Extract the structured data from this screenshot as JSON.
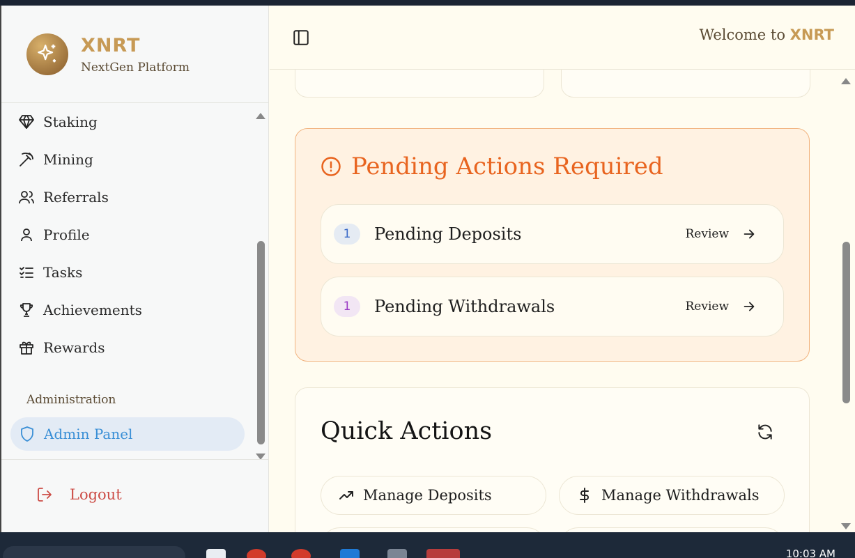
{
  "brand": {
    "name": "XNRT",
    "subtitle": "NextGen Platform"
  },
  "sidebar": {
    "items": [
      {
        "label": "Staking",
        "icon": "gem-icon"
      },
      {
        "label": "Mining",
        "icon": "pickaxe-icon"
      },
      {
        "label": "Referrals",
        "icon": "users-icon"
      },
      {
        "label": "Profile",
        "icon": "user-icon"
      },
      {
        "label": "Tasks",
        "icon": "list-checks-icon"
      },
      {
        "label": "Achievements",
        "icon": "trophy-icon"
      },
      {
        "label": "Rewards",
        "icon": "gift-icon"
      }
    ],
    "section_label": "Administration",
    "admin_label": "Admin Panel",
    "logout_label": "Logout"
  },
  "header": {
    "welcome_prefix": "Welcome to ",
    "welcome_brand": "XNRT"
  },
  "pending": {
    "title": "Pending Actions Required",
    "rows": [
      {
        "count": "1",
        "label": "Pending Deposits",
        "action": "Review"
      },
      {
        "count": "1",
        "label": "Pending Withdrawals",
        "action": "Review"
      }
    ]
  },
  "quick_actions": {
    "title": "Quick Actions",
    "buttons": [
      {
        "label": "Manage Deposits",
        "icon": "trending-up-icon"
      },
      {
        "label": "Manage Withdrawals",
        "icon": "dollar-sign-icon"
      }
    ]
  },
  "taskbar": {
    "time": "10:03 AM"
  },
  "colors": {
    "accent_gold": "#c79a55",
    "pending_orange": "#e8641f",
    "admin_blue": "#3a8fd6",
    "logout_red": "#cc4c46"
  }
}
